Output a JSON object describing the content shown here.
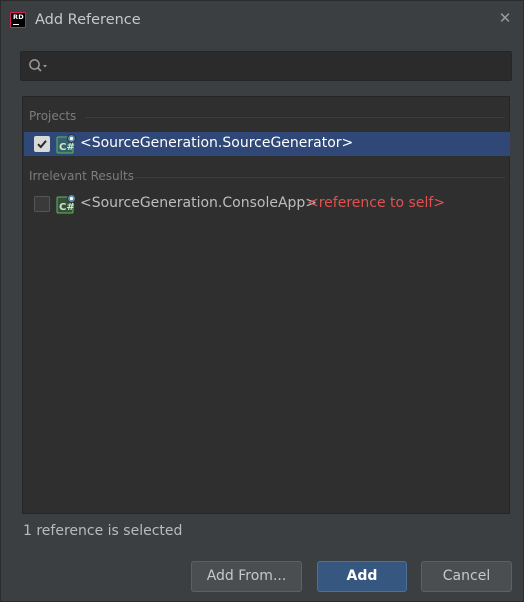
{
  "window": {
    "title": "Add Reference",
    "logo_text": "RD"
  },
  "search": {
    "value": "",
    "placeholder": ""
  },
  "groups": [
    {
      "header": "Projects",
      "items": [
        {
          "label": "<SourceGeneration.SourceGenerator>",
          "checked": true,
          "selected": true,
          "note": ""
        }
      ]
    },
    {
      "header": "Irrelevant Results",
      "items": [
        {
          "label": "<SourceGeneration.ConsoleApp>",
          "checked": false,
          "selected": false,
          "note": "<reference to self>"
        }
      ]
    }
  ],
  "status": {
    "text": "1 reference is selected"
  },
  "buttons": {
    "add_from": "Add From...",
    "add": "Add",
    "cancel": "Cancel"
  },
  "colors": {
    "background": "#3c3f41",
    "list_background": "#2f2f2f",
    "selection": "#2f4877",
    "primary_button": "#365880",
    "note_red": "#e05252",
    "csharp_green": "#4caf50"
  }
}
